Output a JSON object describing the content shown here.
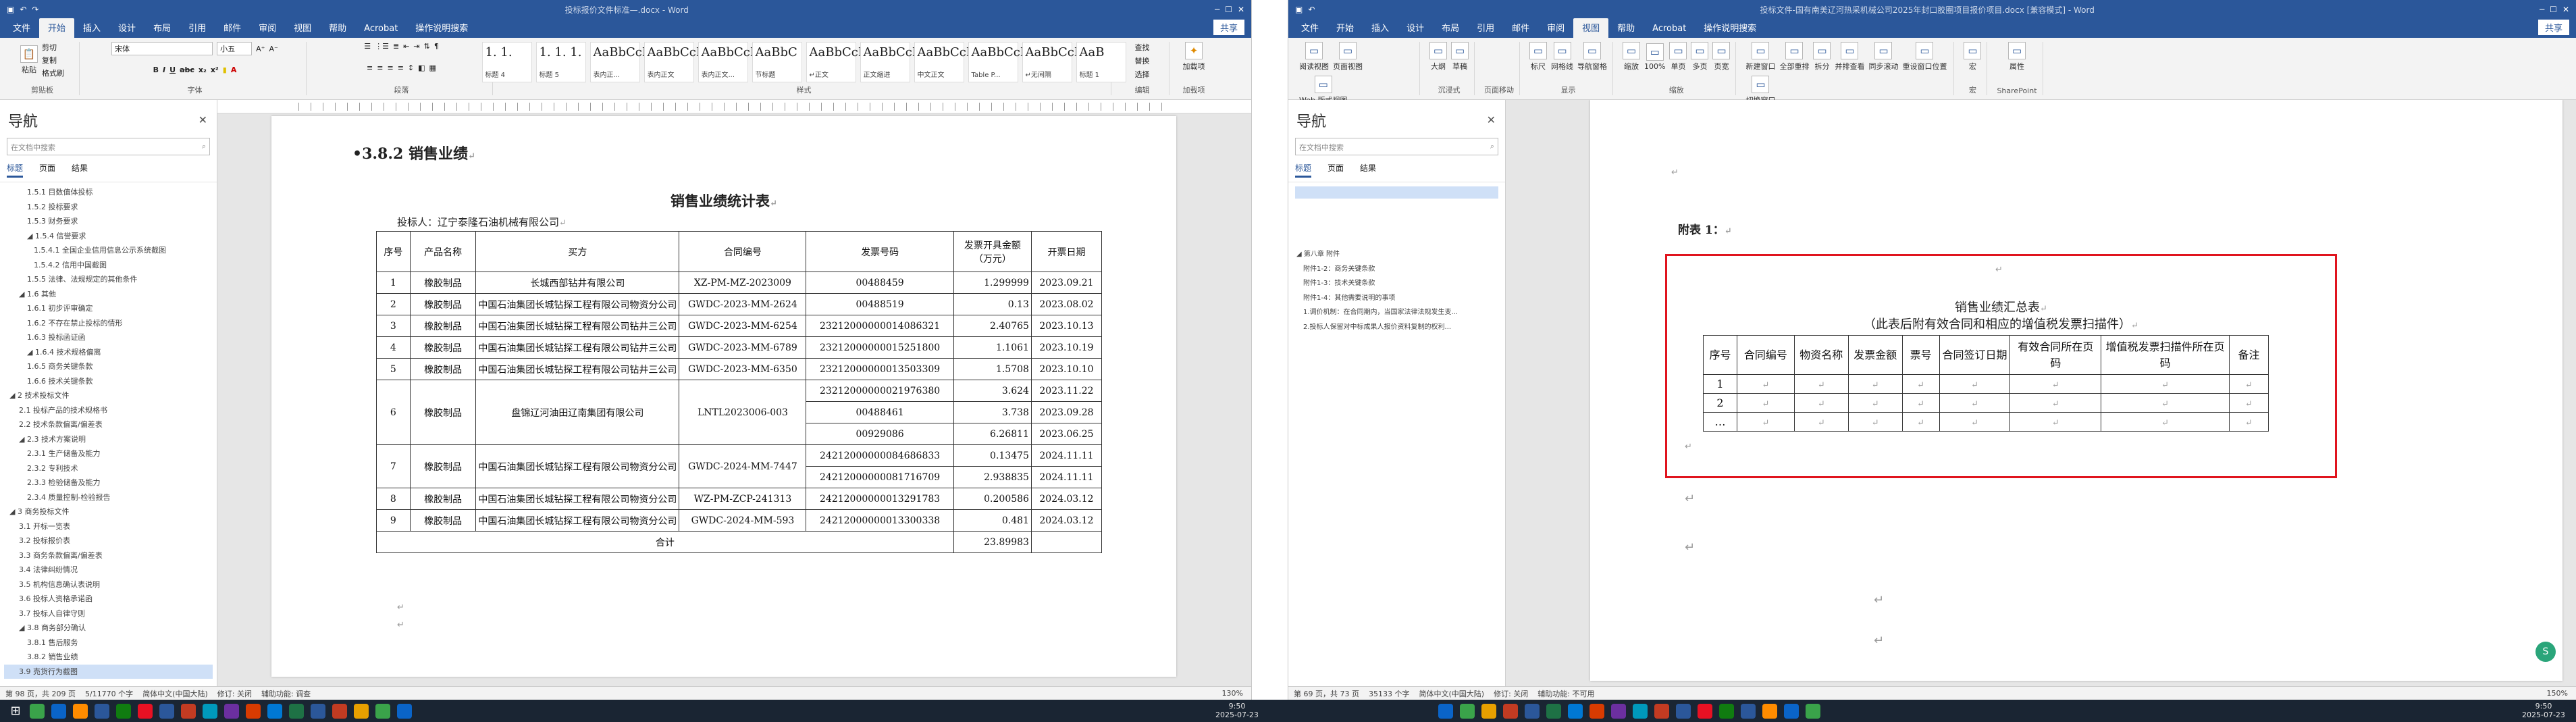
{
  "left": {
    "title": "投标报价文件标准—.docx - Word",
    "share": "共享",
    "tabs": [
      "文件",
      "开始",
      "插入",
      "设计",
      "布局",
      "引用",
      "邮件",
      "审阅",
      "视图",
      "帮助",
      "Acrobat",
      "操作说明搜索"
    ],
    "font_name": "宋体",
    "font_size": "小五",
    "clip": [
      "剪切",
      "复制",
      "格式刷"
    ],
    "group_labels": [
      "剪贴板",
      "字体",
      "段落",
      "样式",
      "编辑",
      "加载项"
    ],
    "styles": [
      {
        "sample": "1. 1.",
        "name": "标题 4"
      },
      {
        "sample": "1. 1. 1.",
        "name": "标题 5"
      },
      {
        "sample": "AaBbCcI",
        "name": "表内正..."
      },
      {
        "sample": "AaBbCcI",
        "name": "表内正文"
      },
      {
        "sample": "AaBbCcI",
        "name": "表内正文..."
      },
      {
        "sample": "AaBbC",
        "name": "节标题"
      },
      {
        "sample": "AaBbCcI",
        "name": "↵正文"
      },
      {
        "sample": "AaBbCcD",
        "name": "正文缩进"
      },
      {
        "sample": "AaBbCcD",
        "name": "中文正文"
      },
      {
        "sample": "AaBbCcD",
        "name": "Table P..."
      },
      {
        "sample": "AaBbCcD",
        "name": "↵无间隔"
      },
      {
        "sample": "AaB",
        "name": "标题 1"
      }
    ],
    "edit": [
      "查找",
      "替换",
      "选择"
    ],
    "addin": "加载项",
    "nav": {
      "title": "导航",
      "search_placeholder": "在文档中搜索",
      "tabs": [
        "标题",
        "页面",
        "结果"
      ],
      "items": [
        "1.5.1 目数值体投标",
        "1.5.2 投标要求",
        "1.5.3 财务要求",
        "◢ 1.5.4 信誉要求",
        "1.5.4.1 全国企业信用信息公示系统截图",
        "1.5.4.2 信用中国截图",
        "1.5.5 法律、法规规定的其他条件",
        "◢ 1.6 其他",
        "1.6.1 初步评审确定",
        "1.6.2 不存在禁止投标的情形",
        "1.6.3 投标函证函",
        "◢ 1.6.4 技术规格偏离",
        "1.6.5 商务关键条款",
        "1.6.6 技术关键条款",
        "◢ 2 技术投标文件",
        "2.1 投标产品的技术规格书",
        "2.2 技术条款偏离/偏差表",
        "◢ 2.3 技术方案说明",
        "2.3.1 生产储备及能力",
        "2.3.2 专利技术",
        "2.3.3 检验储备及能力",
        "2.3.4 质量控制-检验报告",
        "◢ 3 商务投标文件",
        "3.1 开标一览表",
        "3.2 投标报价表",
        "3.3 商务条款偏离/偏差表",
        "3.4 法律纠纷情况",
        "3.5 机构信息确认表说明",
        "3.6 投标人资格承诺函",
        "3.7 投标人自律守则",
        "◢ 3.8 商务部分确认",
        "3.8.1 售后服务",
        "3.8.2 销售业绩",
        "3.9 売货行为截图"
      ],
      "selected": 33
    },
    "doc": {
      "heading": "3.8.2 销售业绩",
      "table_title": "销售业绩统计表",
      "bidder": "投标人：辽宁泰隆石油机械有限公司",
      "headers": [
        "序号",
        "产品名称",
        "买方",
        "合同编号",
        "发票号码",
        "发票开具金额（万元）",
        "开票日期"
      ],
      "rows": [
        {
          "no": "1",
          "product": "橡胶制品",
          "buyer": "长城西部钻井有限公司",
          "contract": "XZ-PM-MZ-2023009",
          "invoices": [
            {
              "num": "00488459",
              "amount": "1.299999",
              "date": "2023.09.21"
            }
          ]
        },
        {
          "no": "2",
          "product": "橡胶制品",
          "buyer": "中国石油集团长城钻探工程有限公司物资分公司",
          "contract": "GWDC-2023-MM-2624",
          "invoices": [
            {
              "num": "00488519",
              "amount": "0.13",
              "date": "2023.08.02"
            }
          ]
        },
        {
          "no": "3",
          "product": "橡胶制品",
          "buyer": "中国石油集团长城钻探工程有限公司钻井三公司",
          "contract": "GWDC-2023-MM-6254",
          "invoices": [
            {
              "num": "23212000000014086321",
              "amount": "2.40765",
              "date": "2023.10.13"
            }
          ]
        },
        {
          "no": "4",
          "product": "橡胶制品",
          "buyer": "中国石油集团长城钻探工程有限公司钻井三公司",
          "contract": "GWDC-2023-MM-6789",
          "invoices": [
            {
              "num": "23212000000015251800",
              "amount": "1.1061",
              "date": "2023.10.19"
            }
          ]
        },
        {
          "no": "5",
          "product": "橡胶制品",
          "buyer": "中国石油集团长城钻探工程有限公司钻井三公司",
          "contract": "GWDC-2023-MM-6350",
          "invoices": [
            {
              "num": "23212000000013503309",
              "amount": "1.5708",
              "date": "2023.10.10"
            }
          ]
        },
        {
          "no": "6",
          "product": "橡胶制品",
          "buyer": "盘锦辽河油田辽南集团有限公司",
          "contract": "LNTL2023006-003",
          "invoices": [
            {
              "num": "23212000000021976380",
              "amount": "3.624",
              "date": "2023.11.22"
            },
            {
              "num": "00488461",
              "amount": "3.738",
              "date": "2023.09.28"
            },
            {
              "num": "00929086",
              "amount": "6.26811",
              "date": "2023.06.25"
            }
          ]
        },
        {
          "no": "7",
          "product": "橡胶制品",
          "buyer": "中国石油集团长城钻探工程有限公司物资分公司",
          "contract": "GWDC-2024-MM-7447",
          "invoices": [
            {
              "num": "24212000000084686833",
              "amount": "0.13475",
              "date": "2024.11.11"
            },
            {
              "num": "24212000000081716709",
              "amount": "2.938835",
              "date": "2024.11.11"
            }
          ]
        },
        {
          "no": "8",
          "product": "橡胶制品",
          "buyer": "中国石油集团长城钻探工程有限公司物资分公司",
          "contract": "WZ-PM-ZCP-241313",
          "invoices": [
            {
              "num": "24212000000013291783",
              "amount": "0.200586",
              "date": "2024.03.12"
            }
          ]
        },
        {
          "no": "9",
          "product": "橡胶制品",
          "buyer": "中国石油集团长城钻探工程有限公司物资分公司",
          "contract": "GWDC-2024-MM-593",
          "invoices": [
            {
              "num": "24212000000013300338",
              "amount": "0.481",
              "date": "2024.03.12"
            }
          ]
        }
      ],
      "total_label": "合计",
      "total_value": "23.89983"
    },
    "status": [
      "第 98 页，共 209 页",
      "5/11770 个字",
      "简体中文(中国大陆)",
      "修订: 关闭",
      "辅助功能: 调查"
    ],
    "zoom": "130%"
  },
  "right": {
    "title": "投标文件-国有南美辽河热采机械公司2025年封口胶圈项目报价项目.docx [兼容模式] - Word",
    "share": "共享",
    "tabs": [
      "文件",
      "开始",
      "插入",
      "设计",
      "布局",
      "引用",
      "邮件",
      "审阅",
      "视图",
      "帮助",
      "Acrobat",
      "操作说明搜索"
    ],
    "view_buttons": [
      "阅读视图",
      "页面视图",
      "Web 版式视图",
      "大纲",
      "草稿",
      "标尺",
      "网格线",
      "导航窗格",
      "缩放",
      "100%",
      "单页",
      "多页",
      "页宽",
      "新建窗口",
      "全部重排",
      "拆分",
      "并排查看",
      "同步滚动",
      "重设窗口位置",
      "切换窗口",
      "宏",
      "属性"
    ],
    "group_labels": [
      "视图",
      "沉浸式",
      "页面移动",
      "显示",
      "缩放",
      "窗口",
      "宏",
      "SharePoint"
    ],
    "nav": {
      "title": "导航",
      "search_placeholder": "在文档中搜索",
      "tabs": [
        "标题",
        "页面",
        "结果"
      ],
      "items": [
        "◢ 第八章  附件",
        "附件1-2：商务关键条款",
        "附件1-3：技术关键条款",
        "附件1-4：其他需要说明的事项",
        "1.调价机制：在合同期内，当国家法律法规发生变...",
        "2.投标人保留对中标成果人报价资料复制的权利..."
      ]
    },
    "doc": {
      "appendix": "附表 1：",
      "title": "销售业绩汇总表",
      "subtitle": "（此表后附有效合同和相应的增值税发票扫描件）",
      "headers": [
        "序号",
        "合同编号",
        "物资名称",
        "发票金额",
        "票号",
        "合同签订日期",
        "有效合同所在页码",
        "增值税发票扫描件所在页码",
        "备注"
      ],
      "rows": [
        "1",
        "2",
        "…"
      ]
    },
    "status": [
      "第 69 页，共 73 页",
      "35133 个字",
      "简体中文(中国大陆)",
      "修订: 关闭",
      "辅助功能: 不可用"
    ],
    "zoom": "150%"
  },
  "taskbar": {
    "left_time": "9:50",
    "left_date": "2025-07-23",
    "right_time": "9:50",
    "right_date": "2025-07-23"
  }
}
